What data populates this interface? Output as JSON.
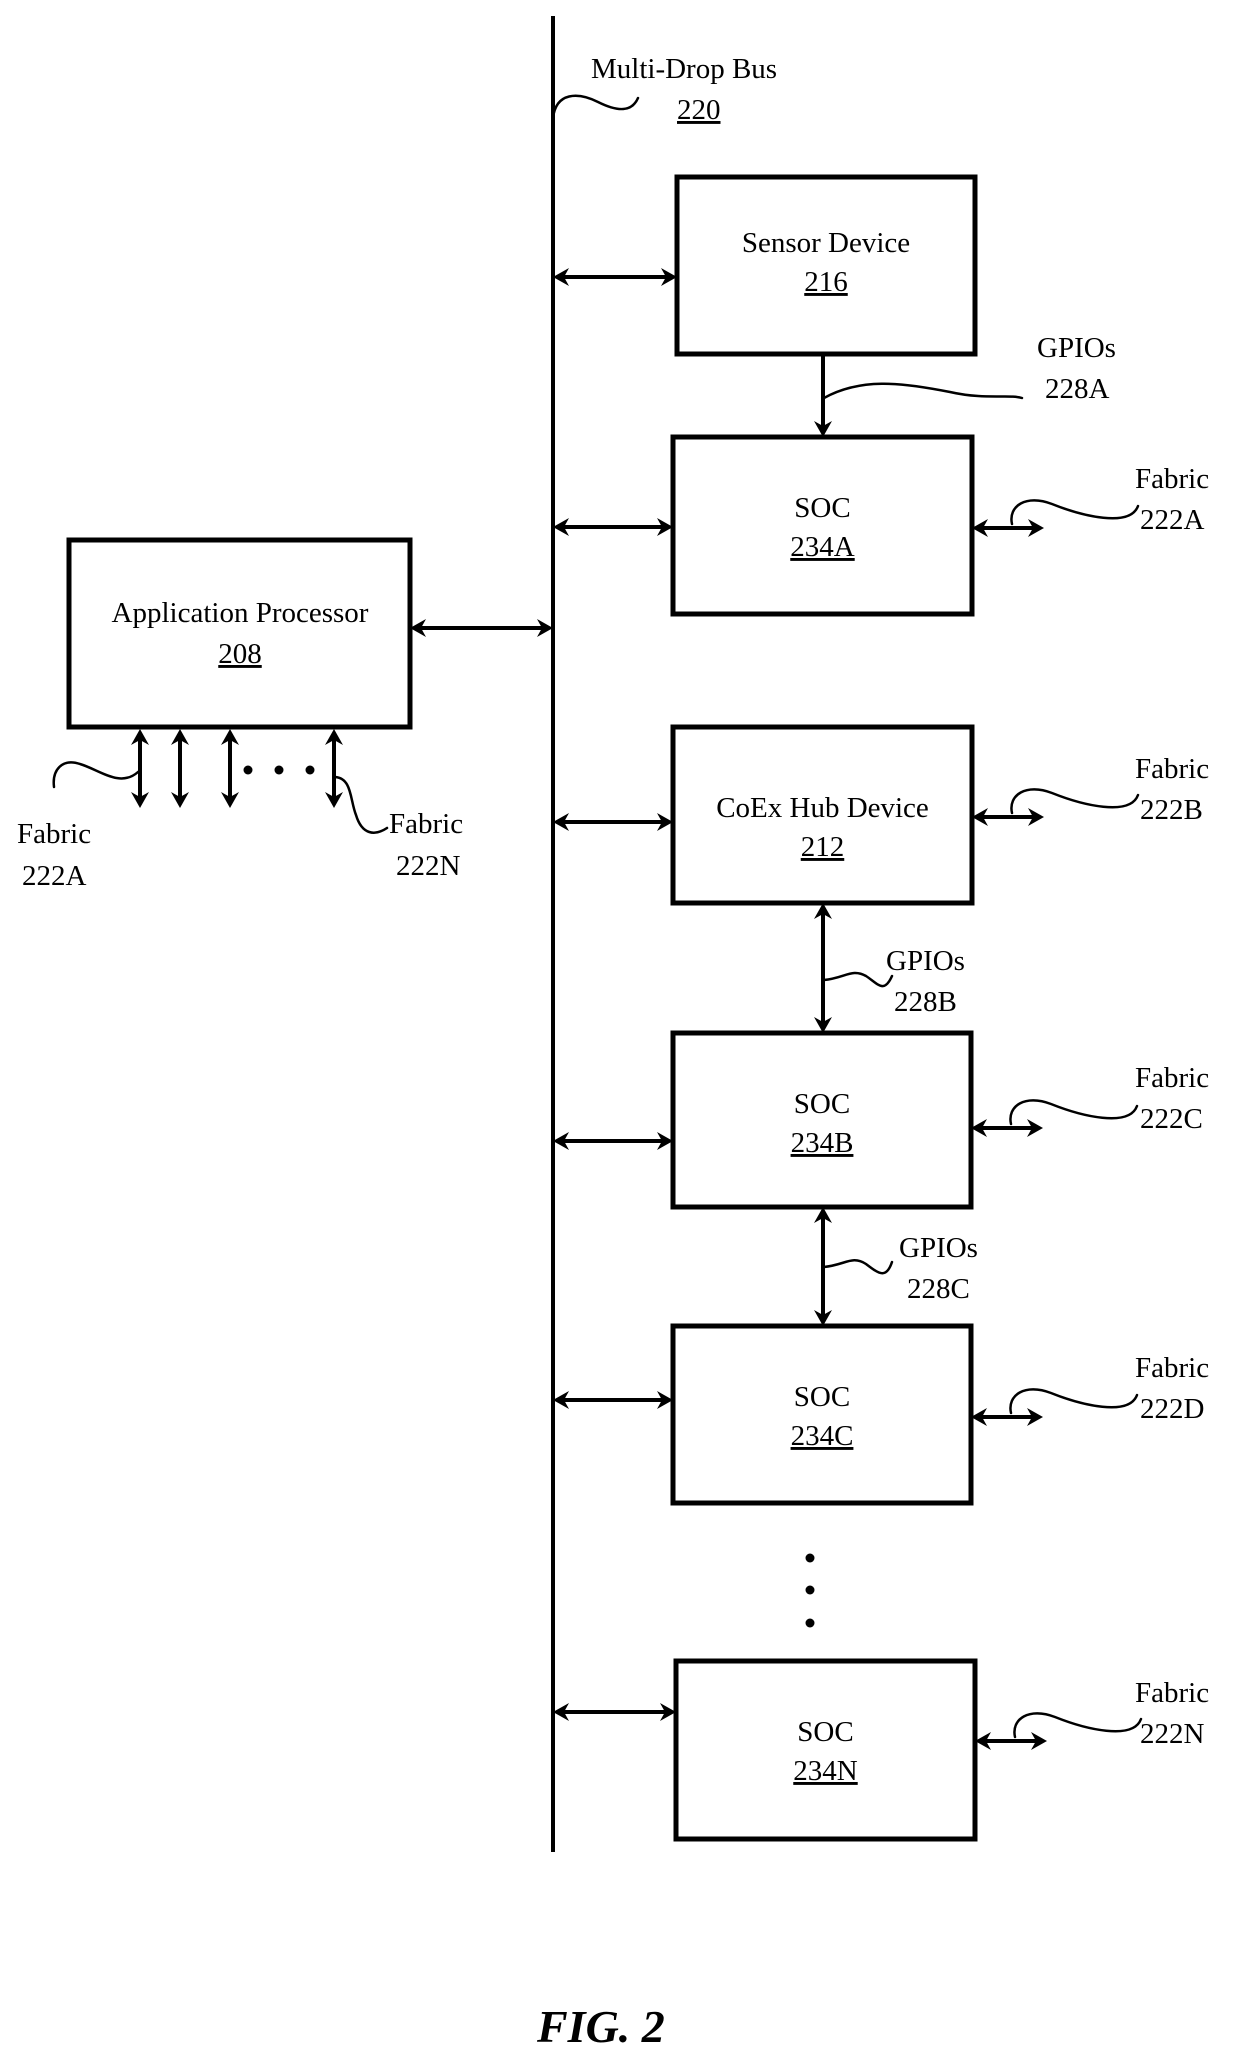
{
  "figure": {
    "caption": "FIG. 2"
  },
  "bus": {
    "name": "Multi-Drop Bus",
    "ref": "220"
  },
  "application_processor": {
    "name": "Application Processor",
    "ref": "208",
    "fabric_first": {
      "label": "Fabric",
      "ref": "222A"
    },
    "fabric_last": {
      "label": "Fabric",
      "ref": "222N"
    }
  },
  "devices": [
    {
      "id": "sensor",
      "name": "Sensor Device",
      "ref": "216"
    },
    {
      "id": "soc-a",
      "name": "SOC",
      "ref": "234A",
      "fabric": {
        "label": "Fabric",
        "ref": "222A"
      }
    },
    {
      "id": "coex",
      "name": "CoEx Hub Device",
      "ref": "212",
      "fabric": {
        "label": "Fabric",
        "ref": "222B"
      }
    },
    {
      "id": "soc-b",
      "name": "SOC",
      "ref": "234B",
      "fabric": {
        "label": "Fabric",
        "ref": "222C"
      }
    },
    {
      "id": "soc-c",
      "name": "SOC",
      "ref": "234C",
      "fabric": {
        "label": "Fabric",
        "ref": "222D"
      }
    },
    {
      "id": "soc-n",
      "name": "SOC",
      "ref": "234N",
      "fabric": {
        "label": "Fabric",
        "ref": "222N"
      }
    }
  ],
  "gpio_links": [
    {
      "label": "GPIOs",
      "ref": "228A",
      "direction": "one-way"
    },
    {
      "label": "GPIOs",
      "ref": "228B",
      "direction": "two-way"
    },
    {
      "label": "GPIOs",
      "ref": "228C",
      "direction": "two-way"
    }
  ]
}
